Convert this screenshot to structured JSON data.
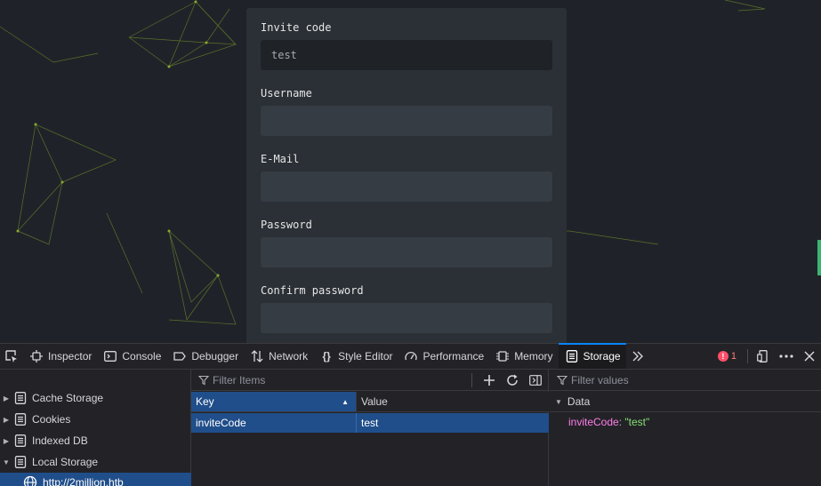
{
  "form": {
    "fields": [
      {
        "label": "Invite code",
        "value": "test",
        "placeholder": ""
      },
      {
        "label": "Username",
        "value": "",
        "placeholder": ""
      },
      {
        "label": "E-Mail",
        "value": "",
        "placeholder": ""
      },
      {
        "label": "Password",
        "value": "",
        "placeholder": ""
      },
      {
        "label": "Confirm password",
        "value": "",
        "placeholder": ""
      }
    ]
  },
  "devtools": {
    "tabs": [
      {
        "label": "Inspector",
        "icon": "inspector-icon"
      },
      {
        "label": "Console",
        "icon": "console-icon"
      },
      {
        "label": "Debugger",
        "icon": "debugger-icon"
      },
      {
        "label": "Network",
        "icon": "network-icon"
      },
      {
        "label": "Style Editor",
        "icon": "style-editor-icon"
      },
      {
        "label": "Performance",
        "icon": "performance-icon"
      },
      {
        "label": "Memory",
        "icon": "memory-icon"
      },
      {
        "label": "Storage",
        "icon": "storage-icon"
      }
    ],
    "active_tab": "Storage",
    "error_count": "1",
    "colors": {
      "accent": "#0a84ff",
      "selection": "#204e8a",
      "error": "#ff4f6a"
    }
  },
  "storage": {
    "tree": [
      {
        "label": "Cache Storage",
        "expanded": false
      },
      {
        "label": "Cookies",
        "expanded": false
      },
      {
        "label": "Indexed DB",
        "expanded": false
      },
      {
        "label": "Local Storage",
        "expanded": true
      },
      {
        "label": "http://2million.htb",
        "child": true,
        "selected": true
      }
    ],
    "filter_items_placeholder": "Filter Items",
    "filter_values_placeholder": "Filter values",
    "columns": {
      "key": "Key",
      "value": "Value"
    },
    "rows": [
      {
        "key": "inviteCode",
        "value": "test"
      }
    ],
    "detail": {
      "section": "Data",
      "key": "inviteCode",
      "value": "\"test\""
    }
  }
}
